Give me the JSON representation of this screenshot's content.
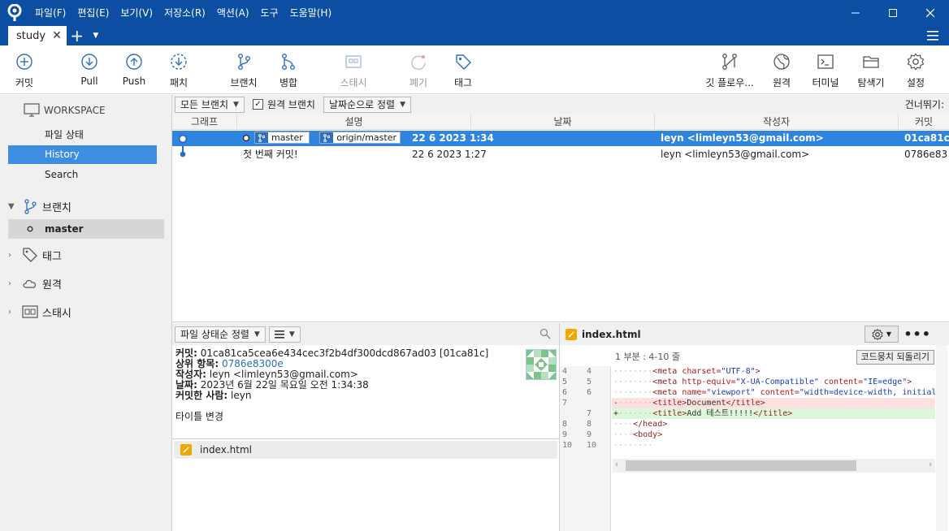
{
  "menu": [
    "파일(F)",
    "편집(E)",
    "보기(V)",
    "저장소(R)",
    "액션(A)",
    "도구",
    "도움말(H)"
  ],
  "tab": {
    "name": "study"
  },
  "toolbar": {
    "commit": "커밋",
    "pull": "Pull",
    "push": "Push",
    "fetch": "패치",
    "branch": "브랜치",
    "merge": "병합",
    "stash": "스태시",
    "discard": "폐기",
    "tag": "태그",
    "gitflow": "깃 플로우...",
    "remote": "원격",
    "terminal": "터미널",
    "explorer": "탐색기",
    "settings": "설정"
  },
  "sidebar": {
    "workspace": "WORKSPACE",
    "items": [
      "파일 상태",
      "History",
      "Search"
    ],
    "branches": "브랜치",
    "current_branch": "master",
    "tags": "태그",
    "remotes": "원격",
    "stashes": "스태시"
  },
  "filterbar": {
    "all_branches": "모든 브랜치",
    "remote_branches": "원격 브랜치",
    "sort": "날짜순으로 정렬",
    "skip": "건너뛰기:"
  },
  "commit_table": {
    "columns": [
      "그래프",
      "설명",
      "날짜",
      "작성자",
      "커밋"
    ],
    "rows": [
      {
        "refs": [
          "master",
          "origin/master"
        ],
        "description": "",
        "date": "22 6 2023 1:34",
        "author": "leyn <limleyn53@gmail.com>",
        "commit": "01ca81c"
      },
      {
        "refs": [],
        "description": "첫 번째 커밋!",
        "date": "22 6 2023 1:27",
        "author": "leyn <limleyn53@gmail.com>",
        "commit": "0786e83"
      }
    ]
  },
  "file_toolbar": {
    "sort": "파일 상태순 정렬"
  },
  "commit_details": {
    "commit_label": "커밋:",
    "commit_value": "01ca81ca5cea6e434cec3f2b4df300dcd867ad03 [01ca81c]",
    "parent_label": "상위 항목:",
    "parent_value": "0786e8300e",
    "author_label": "작성자:",
    "author_value": "leyn <limleyn53@gmail.com>",
    "date_label": "날짜:",
    "date_value": "2023년 6월 22일 목요일 오전 1:34:38",
    "committer_label": "커밋한 사람:",
    "committer_value": "leyn",
    "message": "타이틀 변경"
  },
  "file_list": {
    "file": "index.html"
  },
  "diff": {
    "file": "index.html",
    "hunk": "1 부분 : 4-10 줄",
    "revert": "코드뭉치 되돌리기"
  },
  "colors": {
    "accent": "#0b4ea2",
    "selection": "#2f84e0",
    "sidebar_selection": "#3d8ee0"
  }
}
